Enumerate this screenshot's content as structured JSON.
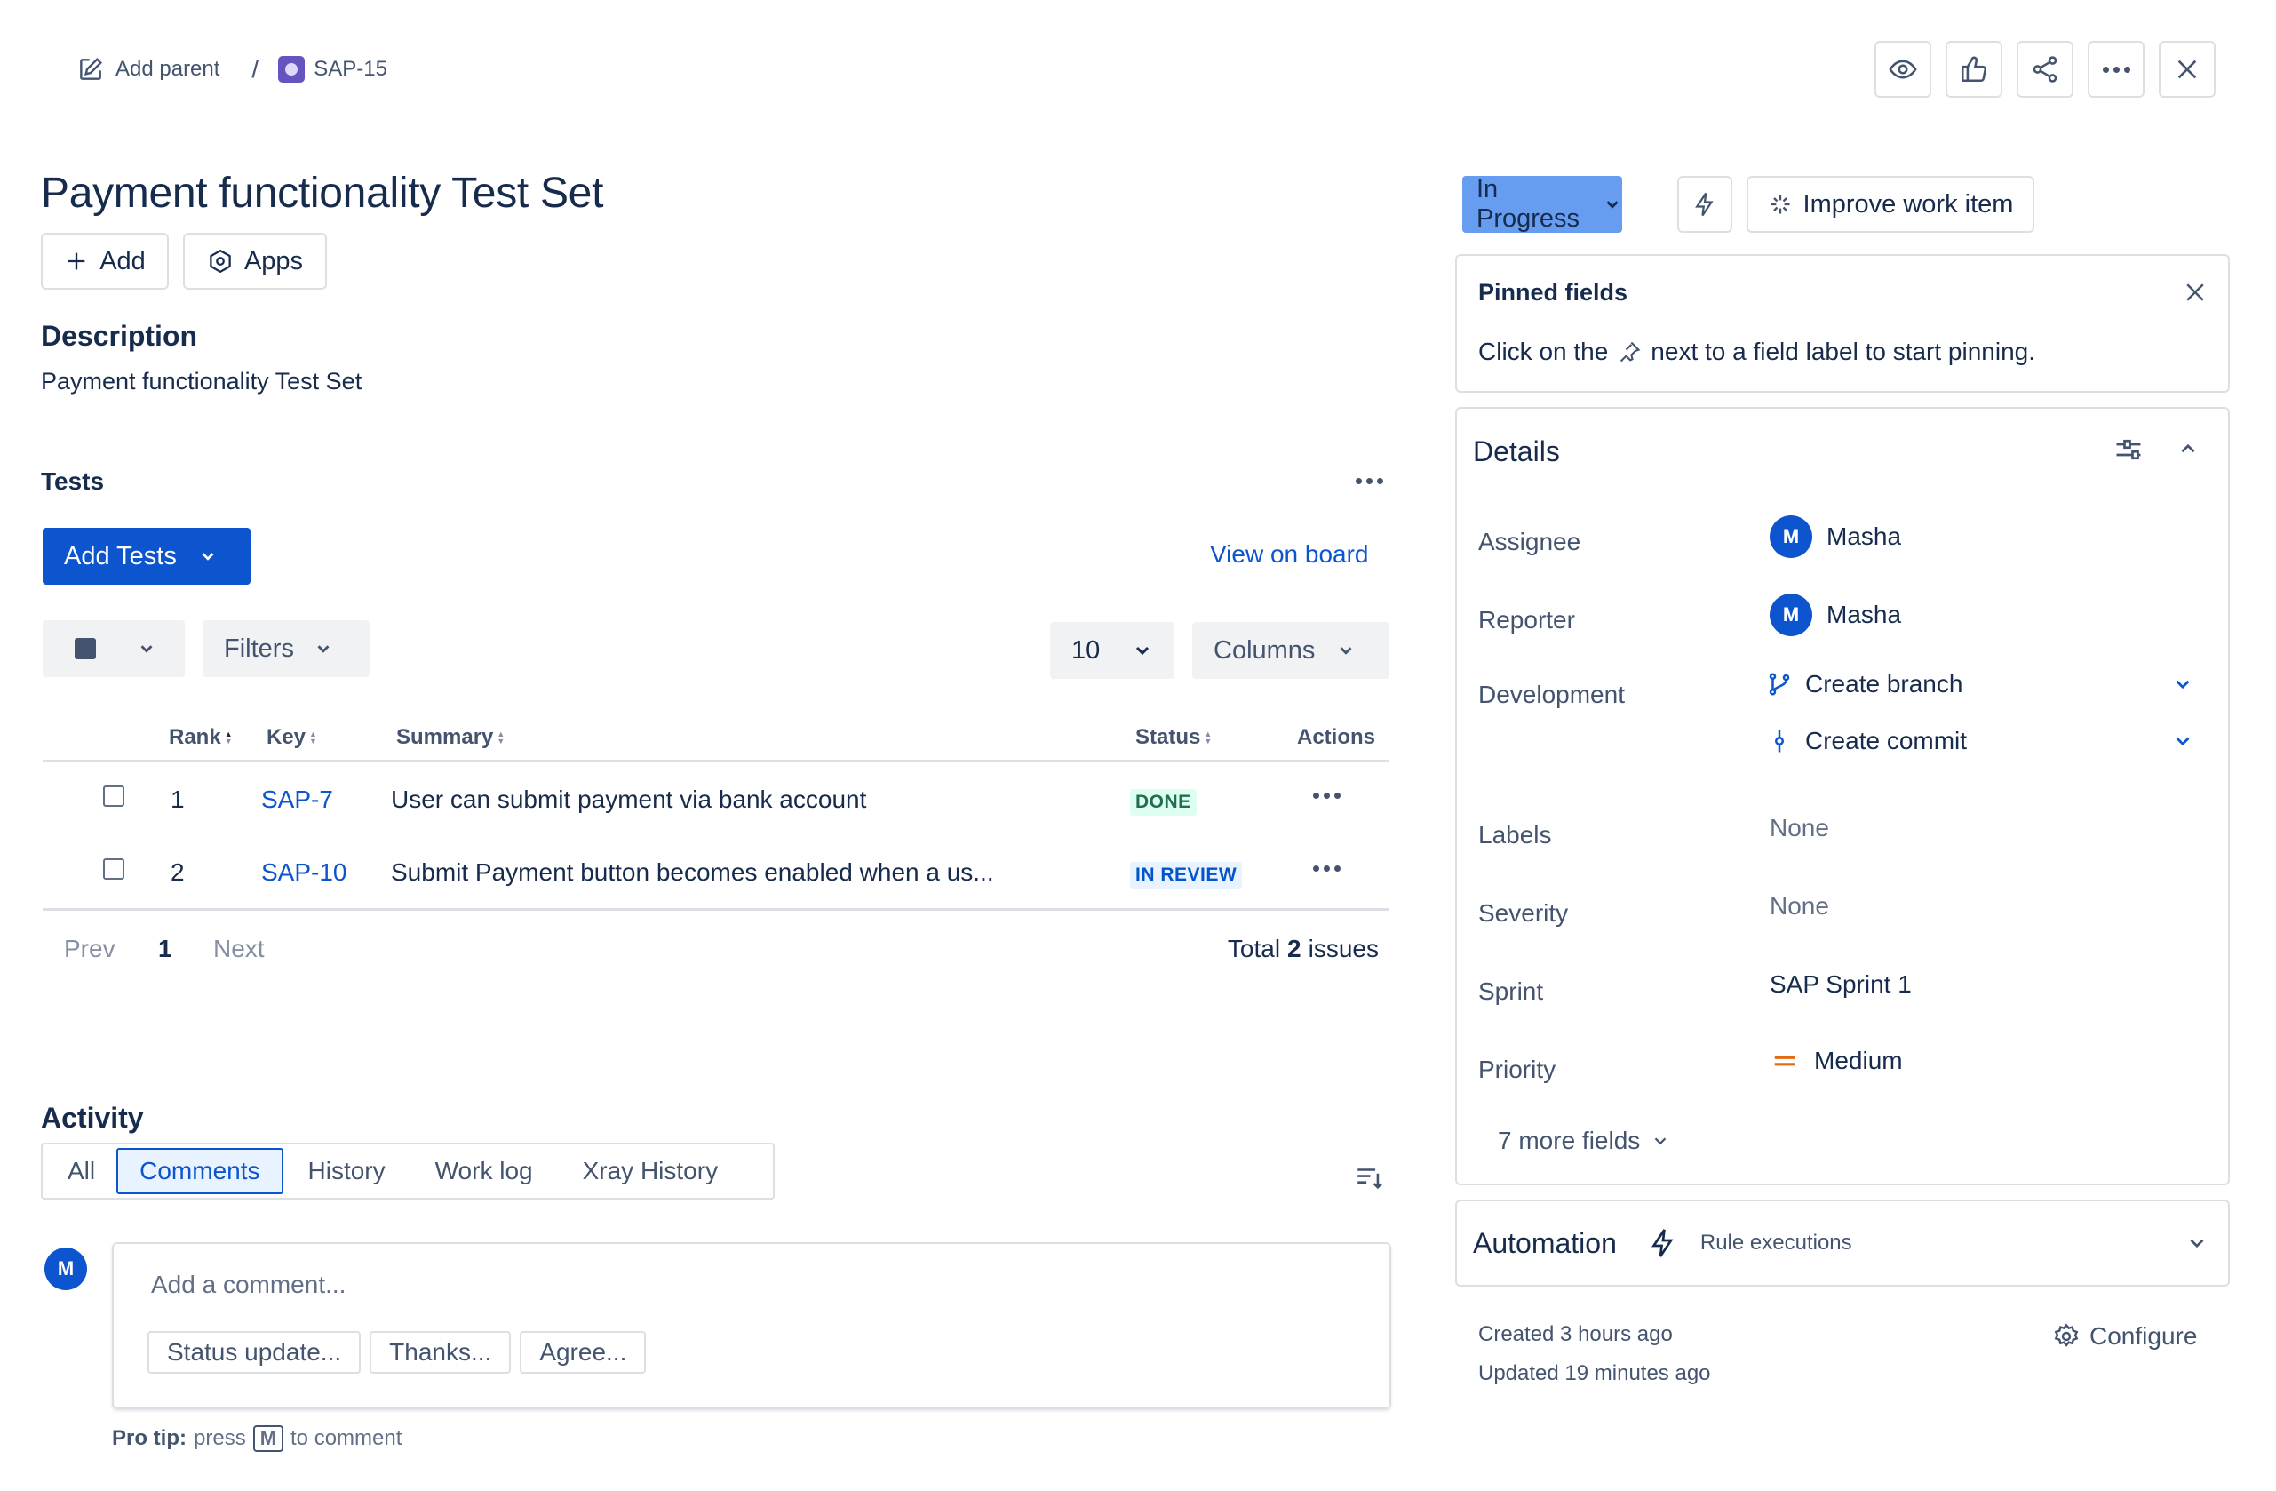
{
  "breadcrumb": {
    "add_parent": "Add parent",
    "separator": "/",
    "issue_key": "SAP-15"
  },
  "issue": {
    "title": "Payment functionality Test Set",
    "add_label": "Add",
    "apps_label": "Apps",
    "description_heading": "Description",
    "description": "Payment functionality Test Set"
  },
  "tests": {
    "heading": "Tests",
    "add_tests_label": "Add Tests",
    "view_on_board": "View on board",
    "filters_label": "Filters",
    "page_size": "10",
    "columns_label": "Columns",
    "headers": {
      "rank": "Rank",
      "key": "Key",
      "summary": "Summary",
      "status": "Status",
      "actions": "Actions"
    },
    "rows": [
      {
        "rank": "1",
        "key": "SAP-7",
        "summary": "User can submit payment via bank account",
        "status": "DONE",
        "status_color": "#216e4e",
        "status_bg": "#dcfff1"
      },
      {
        "rank": "2",
        "key": "SAP-10",
        "summary": "Submit Payment button becomes enabled when a us...",
        "status": "IN REVIEW",
        "status_color": "#0055cc",
        "status_bg": "#e9f2ff"
      }
    ],
    "pager": {
      "prev": "Prev",
      "page": "1",
      "next": "Next",
      "total_prefix": "Total",
      "total_count": "2",
      "total_suffix": "issues"
    }
  },
  "activity": {
    "heading": "Activity",
    "tabs": [
      "All",
      "Comments",
      "History",
      "Work log",
      "Xray History"
    ],
    "active_tab": "Comments",
    "avatar_initial": "M",
    "comment_placeholder": "Add a comment...",
    "quick_replies": [
      "Status update...",
      "Thanks...",
      "Agree..."
    ],
    "pro_tip_label": "Pro tip:",
    "pro_tip_press": "press",
    "pro_tip_key": "M",
    "pro_tip_suffix": "to comment"
  },
  "status_bar": {
    "status": "In Progress",
    "improve": "Improve work item"
  },
  "pinned": {
    "heading": "Pinned fields",
    "hint_before": "Click on the",
    "hint_after": "next to a field label to start pinning."
  },
  "details": {
    "heading": "Details",
    "assignee_label": "Assignee",
    "assignee": "Masha",
    "assignee_initial": "M",
    "reporter_label": "Reporter",
    "reporter": "Masha",
    "reporter_initial": "M",
    "development_label": "Development",
    "create_branch": "Create branch",
    "create_commit": "Create commit",
    "labels_label": "Labels",
    "labels": "None",
    "severity_label": "Severity",
    "severity": "None",
    "sprint_label": "Sprint",
    "sprint": "SAP Sprint 1",
    "priority_label": "Priority",
    "priority": "Medium",
    "more_fields": "7 more fields"
  },
  "automation": {
    "heading": "Automation",
    "rule_executions": "Rule executions"
  },
  "meta": {
    "created": "Created 3 hours ago",
    "updated": "Updated 19 minutes ago",
    "configure": "Configure"
  },
  "colors": {
    "accent": "#0c55cf",
    "status_button": "#669df1",
    "priority": "#e56910"
  }
}
